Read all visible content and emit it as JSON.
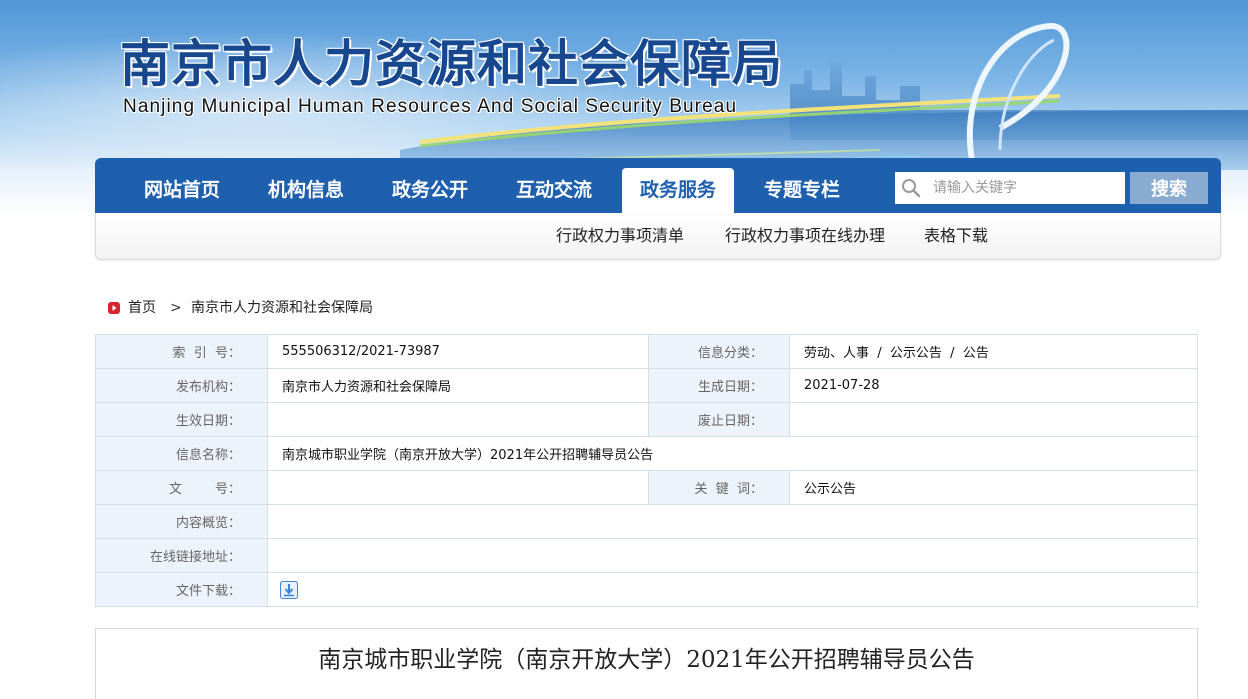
{
  "header": {
    "title": "南京市人力资源和社会保障局",
    "subtitle": "Nanjing Municipal Human Resources And Social Security Bureau"
  },
  "nav": {
    "items": [
      {
        "label": "网站首页"
      },
      {
        "label": "机构信息"
      },
      {
        "label": "政务公开"
      },
      {
        "label": "互动交流"
      },
      {
        "label": "政务服务",
        "active": true
      },
      {
        "label": "专题专栏"
      }
    ],
    "search": {
      "placeholder": "请输入关键字",
      "button_label": "搜索"
    }
  },
  "subnav": {
    "items": [
      {
        "label": "行政权力事项清单"
      },
      {
        "label": "行政权力事项在线办理"
      },
      {
        "label": "表格下载"
      }
    ]
  },
  "breadcrumb": {
    "items": [
      "首页",
      "南京市人力资源和社会保障局"
    ],
    "separator": ">"
  },
  "info": {
    "index_no": {
      "label": "索  引  号：",
      "value": "555506312/2021-73987"
    },
    "category": {
      "label": "信息分类：",
      "value": "劳动、人事  /  公示公告  /  公告"
    },
    "publisher": {
      "label": "发布机构：",
      "value": "南京市人力资源和社会保障局"
    },
    "created_date": {
      "label": "生成日期：",
      "value": "2021-07-28"
    },
    "effective_date": {
      "label": "生效日期：",
      "value": ""
    },
    "expiry_date": {
      "label": "废止日期：",
      "value": ""
    },
    "name": {
      "label": "信息名称：",
      "value": "南京城市职业学院（南京开放大学）2021年公开招聘辅导员公告"
    },
    "doc_no": {
      "label": "文        号：",
      "value": ""
    },
    "keywords": {
      "label": "关  键  词：",
      "value": "公示公告"
    },
    "summary": {
      "label": "内容概览：",
      "value": ""
    },
    "online_link": {
      "label": "在线链接地址：",
      "value": ""
    },
    "file_download": {
      "label": "文件下载：",
      "icon": "download-icon"
    }
  },
  "article": {
    "title": "南京城市职业学院（南京开放大学）2021年公开招聘辅导员公告"
  },
  "colors": {
    "nav_blue": "#1e5fae",
    "title_blue": "#16478f",
    "label_bg": "#edf3fb",
    "search_button": "#8aabd1",
    "home_icon_red": "#d9232d"
  }
}
